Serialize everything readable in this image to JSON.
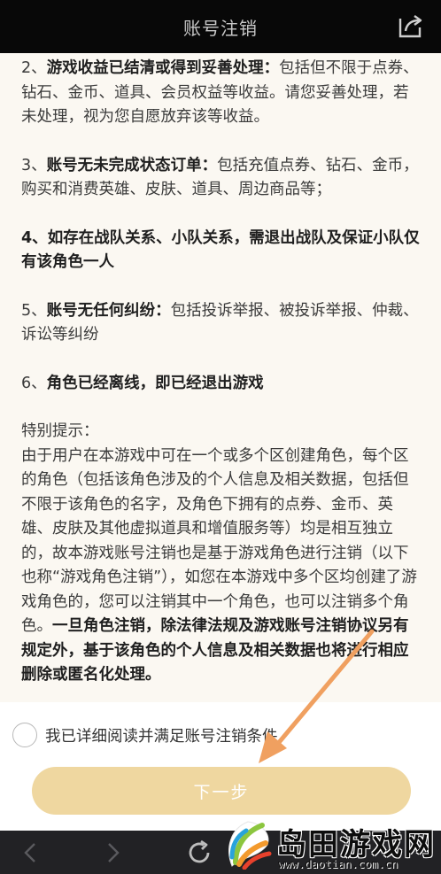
{
  "header": {
    "title": "账号注销",
    "share_icon": "share-icon"
  },
  "content": {
    "items": [
      {
        "prefix": "2、",
        "bold": "游戏收益已结清或得到妥善处理：",
        "rest": "包括但不限于点券、钻石、金币、道具、会员权益等收益。请您妥善处理，若未处理，视为您自愿放弃该等收益。"
      },
      {
        "prefix": "3、",
        "bold": "账号无未完成状态订单：",
        "rest": "包括充值点券、钻石、金币，购买和消费英雄、皮肤、道具、周边商品等；"
      },
      {
        "prefix": "4、",
        "bold": "如存在战队关系、小队关系，需退出战队及保证小队仅有该角色一人",
        "rest": ""
      },
      {
        "prefix": "5、",
        "bold": "账号无任何纠纷：",
        "rest": "包括投诉举报、被投诉举报、仲裁、诉讼等纠纷"
      },
      {
        "prefix": "6、",
        "bold": "角色已经离线，即已经退出游戏",
        "rest": ""
      }
    ],
    "tip_title": "特别提示：",
    "tip_body": "由于用户在本游戏中可在一个或多个区创建角色，每个区的角色（包括该角色涉及的个人信息及相关数据，包括但不限于该角色的名字，及角色下拥有的点券、金币、英雄、皮肤及其他虚拟道具和增值服务等）均是相互独立的，故本游戏账号注销也是基于游戏角色进行注销（以下也称“游戏角色注销”），如您在本游戏中多个区均创建了游戏角色的，您可以注销其中一个角色，也可以注销多个角色。",
    "tip_bold": "一旦角色注销，除法律法规及游戏账号注销协议另有规定外，基于该角色的个人信息及相关数据也将进行相应删除或匿名化处理。"
  },
  "agree": {
    "label": "我已详细阅读并满足账号注销条件",
    "checked": false
  },
  "next_button": {
    "label": "下一步"
  },
  "navbar": {
    "icons": [
      "back-icon",
      "forward-icon",
      "refresh-icon"
    ]
  },
  "watermark": {
    "name": "岛田游戏网",
    "url": "www.daotian.com.cn"
  },
  "colors": {
    "topbar": "#080808",
    "button": "#efd7a0",
    "arrow": "#f0a060",
    "navbar": "#222225"
  }
}
